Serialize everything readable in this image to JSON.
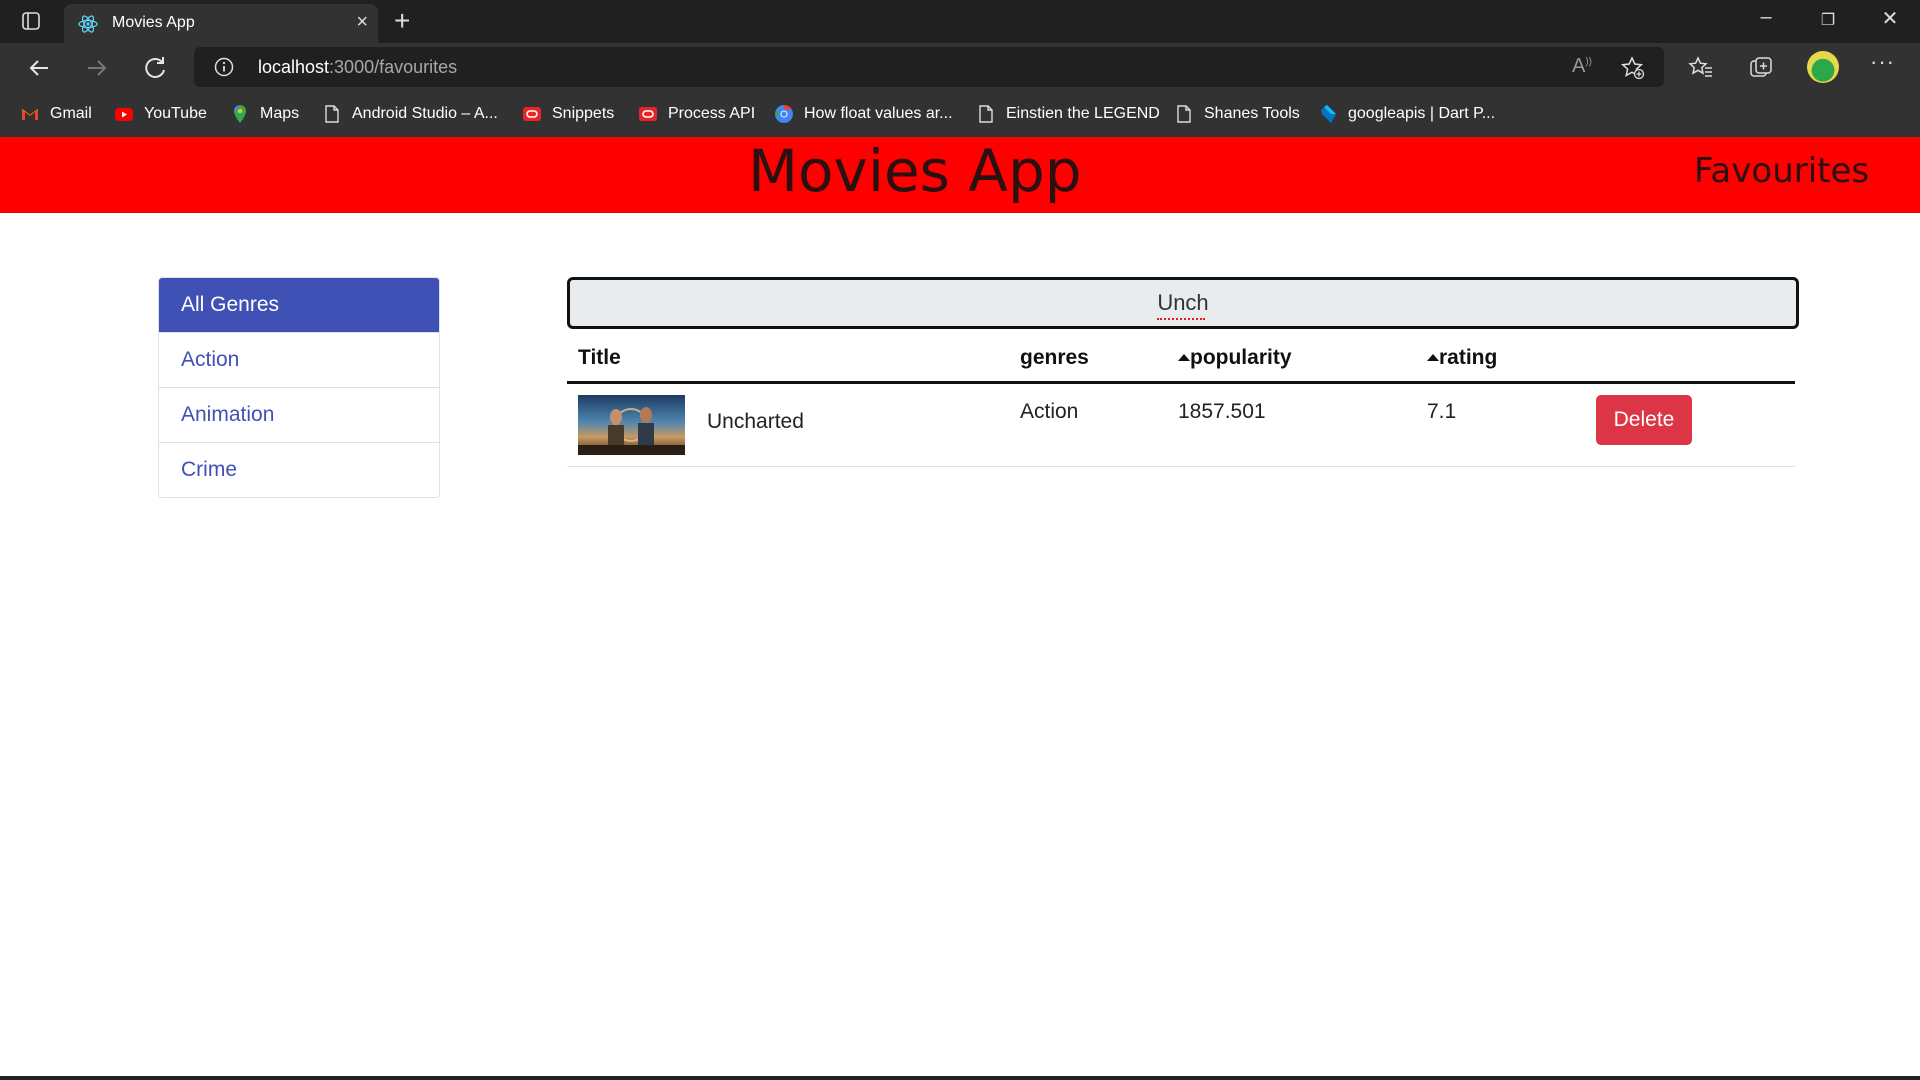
{
  "browser": {
    "tab_title": "Movies App",
    "address_host": "localhost",
    "address_path": ":3000/favourites",
    "bookmarks": [
      {
        "label": "Gmail",
        "icon": "gmail-icon"
      },
      {
        "label": "YouTube",
        "icon": "youtube-icon"
      },
      {
        "label": "Maps",
        "icon": "maps-icon"
      },
      {
        "label": "Android Studio – A...",
        "icon": "page-icon"
      },
      {
        "label": "Snippets",
        "icon": "oracle-icon"
      },
      {
        "label": "Process API",
        "icon": "oracle-icon"
      },
      {
        "label": "How float values ar...",
        "icon": "chrome-icon"
      },
      {
        "label": "Einstien the LEGEND",
        "icon": "page-icon"
      },
      {
        "label": "Shanes Tools",
        "icon": "page-icon"
      },
      {
        "label": "googleapis | Dart P...",
        "icon": "dart-icon"
      }
    ]
  },
  "navbar": {
    "brand": "Movies App",
    "favourites_link": "Favourites",
    "color": "#ff0000"
  },
  "genres": {
    "items": [
      "All Genres",
      "Action",
      "Animation",
      "Crime"
    ],
    "active": "All Genres",
    "accent": "#3f51b5"
  },
  "search": {
    "value": "Unch"
  },
  "table": {
    "headers": {
      "title": "Title",
      "genres": "genres",
      "popularity": "popularity",
      "rating": "rating"
    },
    "rows": [
      {
        "title": "Uncharted",
        "genre": "Action",
        "popularity": "1857.501",
        "rating": "7.1",
        "action": "Delete"
      }
    ]
  }
}
